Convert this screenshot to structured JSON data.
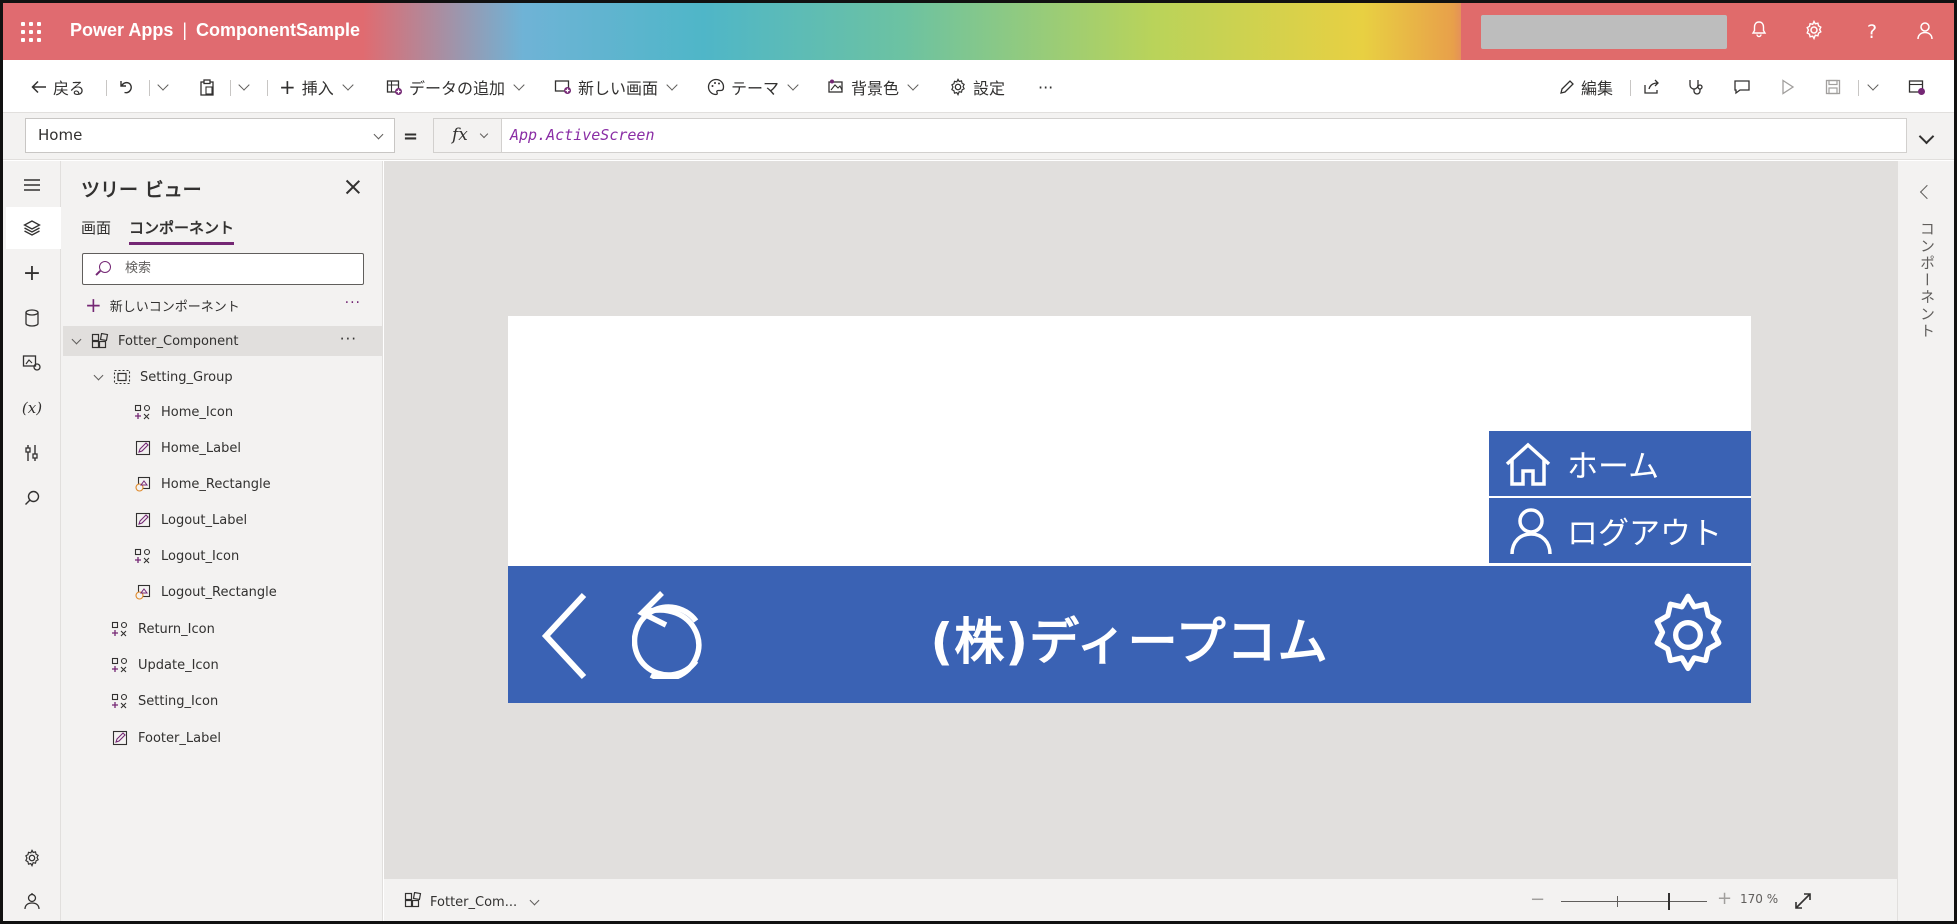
{
  "header": {
    "app_name": "Power Apps",
    "separator": "|",
    "project_name": "ComponentSample"
  },
  "commandbar": {
    "back": "戻る",
    "insert": "挿入",
    "add_data": "データの追加",
    "new_screen": "新しい画面",
    "theme": "テーマ",
    "background": "背景色",
    "settings": "設定",
    "more": "···",
    "edit": "編集"
  },
  "formula": {
    "property": "Home",
    "equals": "=",
    "fx": "fx",
    "expression": "App.ActiveScreen"
  },
  "tree": {
    "title": "ツリー ビュー",
    "tabs": [
      {
        "label": "画面"
      },
      {
        "label": "コンポーネント"
      }
    ],
    "search_placeholder": "検索",
    "new_component": "新しいコンポーネント",
    "nodes": [
      {
        "label": "Fotter_Component"
      },
      {
        "label": "Setting_Group"
      },
      {
        "label": "Home_Icon"
      },
      {
        "label": "Home_Label"
      },
      {
        "label": "Home_Rectangle"
      },
      {
        "label": "Logout_Label"
      },
      {
        "label": "Logout_Icon"
      },
      {
        "label": "Logout_Rectangle"
      },
      {
        "label": "Return_Icon"
      },
      {
        "label": "Update_Icon"
      },
      {
        "label": "Setting_Icon"
      },
      {
        "label": "Footer_Label"
      }
    ]
  },
  "canvas": {
    "home_label": "ホーム",
    "logout_label": "ログアウト",
    "footer_label": "(株)ディープコム",
    "bar_color": "#3a62b4"
  },
  "right_panel": {
    "label": "コンポーネント"
  },
  "status": {
    "component": "Fotter_Com...",
    "zoom": "170 %"
  }
}
